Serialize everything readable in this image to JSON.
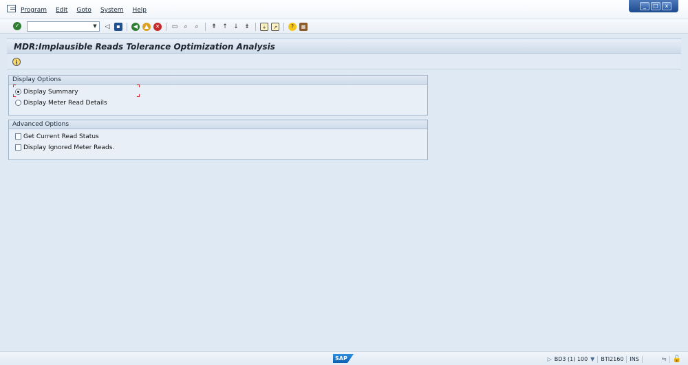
{
  "menu": {
    "items": [
      {
        "label": "Program"
      },
      {
        "label": "Edit"
      },
      {
        "label": "Goto"
      },
      {
        "label": "System"
      },
      {
        "label": "Help"
      }
    ]
  },
  "window_controls": {
    "minimize": "_",
    "maximize": "□",
    "close": "x"
  },
  "toolbar": {
    "command_field": {
      "value": "",
      "placeholder": ""
    },
    "icons": [
      "enter-icon",
      "back-icon",
      "save-icon",
      "back-green-icon",
      "exit-icon",
      "cancel-icon",
      "print-icon",
      "find-icon",
      "find-next-icon",
      "first-page-icon",
      "prev-page-icon",
      "next-page-icon",
      "last-page-icon",
      "create-session-icon",
      "shortcut-icon",
      "help-icon",
      "customize-layout-icon"
    ]
  },
  "title": "MDR:Implausible Reads Tolerance Optimization Analysis",
  "display_options": {
    "header": "Display Options",
    "options": [
      {
        "label": "Display Summary",
        "selected": true
      },
      {
        "label": "Display Meter Read Details",
        "selected": false
      }
    ]
  },
  "advanced_options": {
    "header": "Advanced Options",
    "options": [
      {
        "label": "Get Current Read Status",
        "checked": false
      },
      {
        "label": "Display Ignored Meter Reads.",
        "checked": false
      }
    ]
  },
  "status": {
    "system": "BD3 (1) 100",
    "server": "BTI2160",
    "mode": "INS",
    "logo": "SAP"
  }
}
